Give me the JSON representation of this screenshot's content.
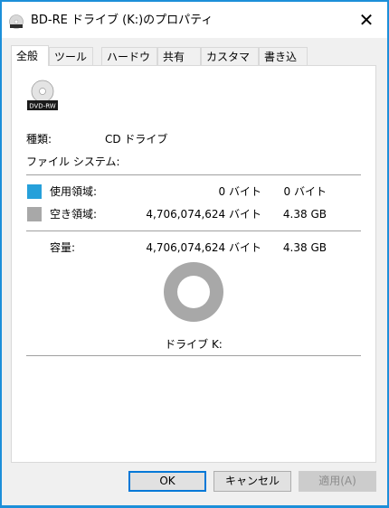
{
  "window": {
    "title": "BD-RE ドライブ (K:)のプロパティ",
    "close_glyph": "✕"
  },
  "tabs": [
    {
      "label": "全般"
    },
    {
      "label": "ツール"
    },
    {
      "label": "ハードウェア"
    },
    {
      "label": "共有"
    },
    {
      "label": "カスタマイズ"
    },
    {
      "label": "書き込み"
    }
  ],
  "general": {
    "icon_badge": "DVD-RW",
    "type_label": "種類:",
    "type_value": "CD ドライブ",
    "fs_label": "ファイル システム:",
    "used": {
      "label": "使用領域:",
      "bytes": "0 バイト",
      "size": "0 バイト",
      "color": "#26a0da"
    },
    "free": {
      "label": "空き領域:",
      "bytes": "4,706,074,624 バイト",
      "size": "4.38 GB",
      "color": "#a8a8a8"
    },
    "capacity": {
      "label": "容量:",
      "bytes": "4,706,074,624 バイト",
      "size": "4.38 GB"
    },
    "drive_label": "ドライブ K:",
    "used_fraction": 0
  },
  "buttons": {
    "ok": "OK",
    "cancel": "キャンセル",
    "apply": "適用(A)"
  }
}
